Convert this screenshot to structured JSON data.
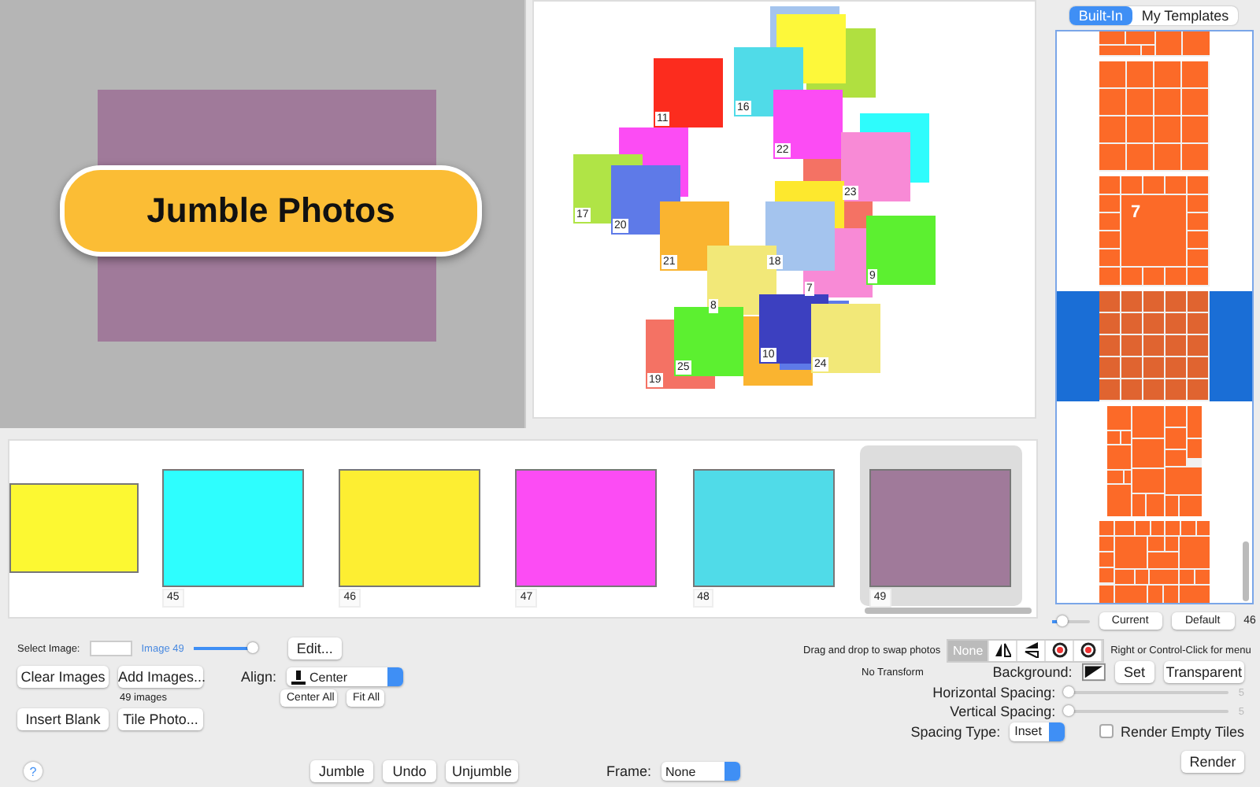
{
  "preview": {
    "title": "Jumble Photos"
  },
  "canvas": {
    "tiles": [
      {
        "color": "#a4c4ee"
      },
      {
        "color": "#b0e040"
      },
      {
        "color": "#fdf83a"
      },
      {
        "label": "16",
        "color": "#50dbe8"
      },
      {
        "label": "11",
        "color": "#fc2c1e"
      },
      {
        "color": "#fc4cf4"
      },
      {
        "label": "17",
        "color": "#b0e446"
      },
      {
        "label": "20",
        "color": "#5e7ae8"
      },
      {
        "color": "#f47264"
      },
      {
        "color": "#2efcfc"
      },
      {
        "label": "22",
        "color": "#fc4cf4"
      },
      {
        "label": "23",
        "color": "#f88ad6"
      },
      {
        "color": "#fde82e"
      },
      {
        "label": "21",
        "color": "#fab430"
      },
      {
        "label": "7",
        "color": "#f88ad6"
      },
      {
        "label": "18",
        "color": "#a4c4ee"
      },
      {
        "label": "9",
        "color": "#5cf030"
      },
      {
        "label": "8",
        "color": "#f2e878"
      },
      {
        "color": "#fab430"
      },
      {
        "color": "#5e7ae8"
      },
      {
        "label": "19",
        "color": "#f47264"
      },
      {
        "label": "25",
        "color": "#5cf030"
      },
      {
        "label": "10",
        "color": "#3c40c0"
      },
      {
        "label": "24",
        "color": "#f2e878"
      }
    ]
  },
  "filmstrip": {
    "items": [
      {
        "kind": "wide",
        "color": "#fcf832",
        "selected": false
      },
      {
        "kind": "square",
        "label": "45",
        "color": "#2efefe",
        "selected": false
      },
      {
        "kind": "square",
        "label": "46",
        "color": "#fdee32",
        "selected": false
      },
      {
        "kind": "square",
        "label": "47",
        "color": "#fc4cf4",
        "selected": false
      },
      {
        "kind": "square",
        "label": "48",
        "color": "#50dbe8",
        "selected": false
      },
      {
        "kind": "square",
        "label": "49",
        "color": "#a07a9a",
        "selected": true
      }
    ]
  },
  "templates": {
    "tabs": [
      {
        "label": "Built-In",
        "selected": true
      },
      {
        "label": "My Templates",
        "selected": false
      }
    ],
    "items": [
      {
        "kind": "strip",
        "selected": false
      },
      {
        "kind": "grid4",
        "selected": false
      },
      {
        "kind": "feature",
        "label": "7",
        "selected": false
      },
      {
        "kind": "grid5",
        "selected": true
      },
      {
        "kind": "mosaic-a",
        "selected": false
      },
      {
        "kind": "mosaic-b",
        "selected": false
      }
    ],
    "zoom": {
      "level": 0.3
    },
    "current": "Current",
    "default": "Default",
    "count": "46"
  },
  "controls": {
    "select_label": "Select Image:",
    "image_name": "Image 49",
    "image_slider": {
      "level": 1
    },
    "edit": "Edit...",
    "clear": "Clear Images",
    "add": "Add Images...",
    "image_count": "49 images",
    "insert": "Insert Blank",
    "tile": "Tile Photo...",
    "align_label": "Align:",
    "align_value": "Center",
    "center_all": "Center All",
    "fit_all": "Fit All",
    "help": "?",
    "jumble": "Jumble",
    "undo": "Undo",
    "unjumble": "Unjumble",
    "frame_label": "Frame:",
    "frame_value": "None",
    "drag_hint": "Drag and drop to swap photos",
    "transforms": [
      {
        "kind": "text",
        "label": "None",
        "selected": true
      },
      {
        "kind": "flip-h",
        "selected": false
      },
      {
        "kind": "flip-v",
        "selected": false
      },
      {
        "kind": "rotate-left",
        "selected": false
      },
      {
        "kind": "rotate-right",
        "selected": false
      }
    ],
    "transform_name": "No Transform",
    "menu_hint": "Right or Control-Click for menu",
    "background_label": "Background:",
    "set": "Set",
    "transparent": "Transparent",
    "h_spacing": {
      "label": "Horizontal Spacing:",
      "level": 0.03,
      "reading": "5"
    },
    "v_spacing": {
      "label": "Vertical Spacing:",
      "level": 0.03,
      "reading": "5"
    },
    "spacing_type_label": "Spacing Type:",
    "spacing_type": "Inset",
    "render_empty": {
      "label": "Render Empty Tiles",
      "checked": false
    },
    "render": "Render"
  }
}
